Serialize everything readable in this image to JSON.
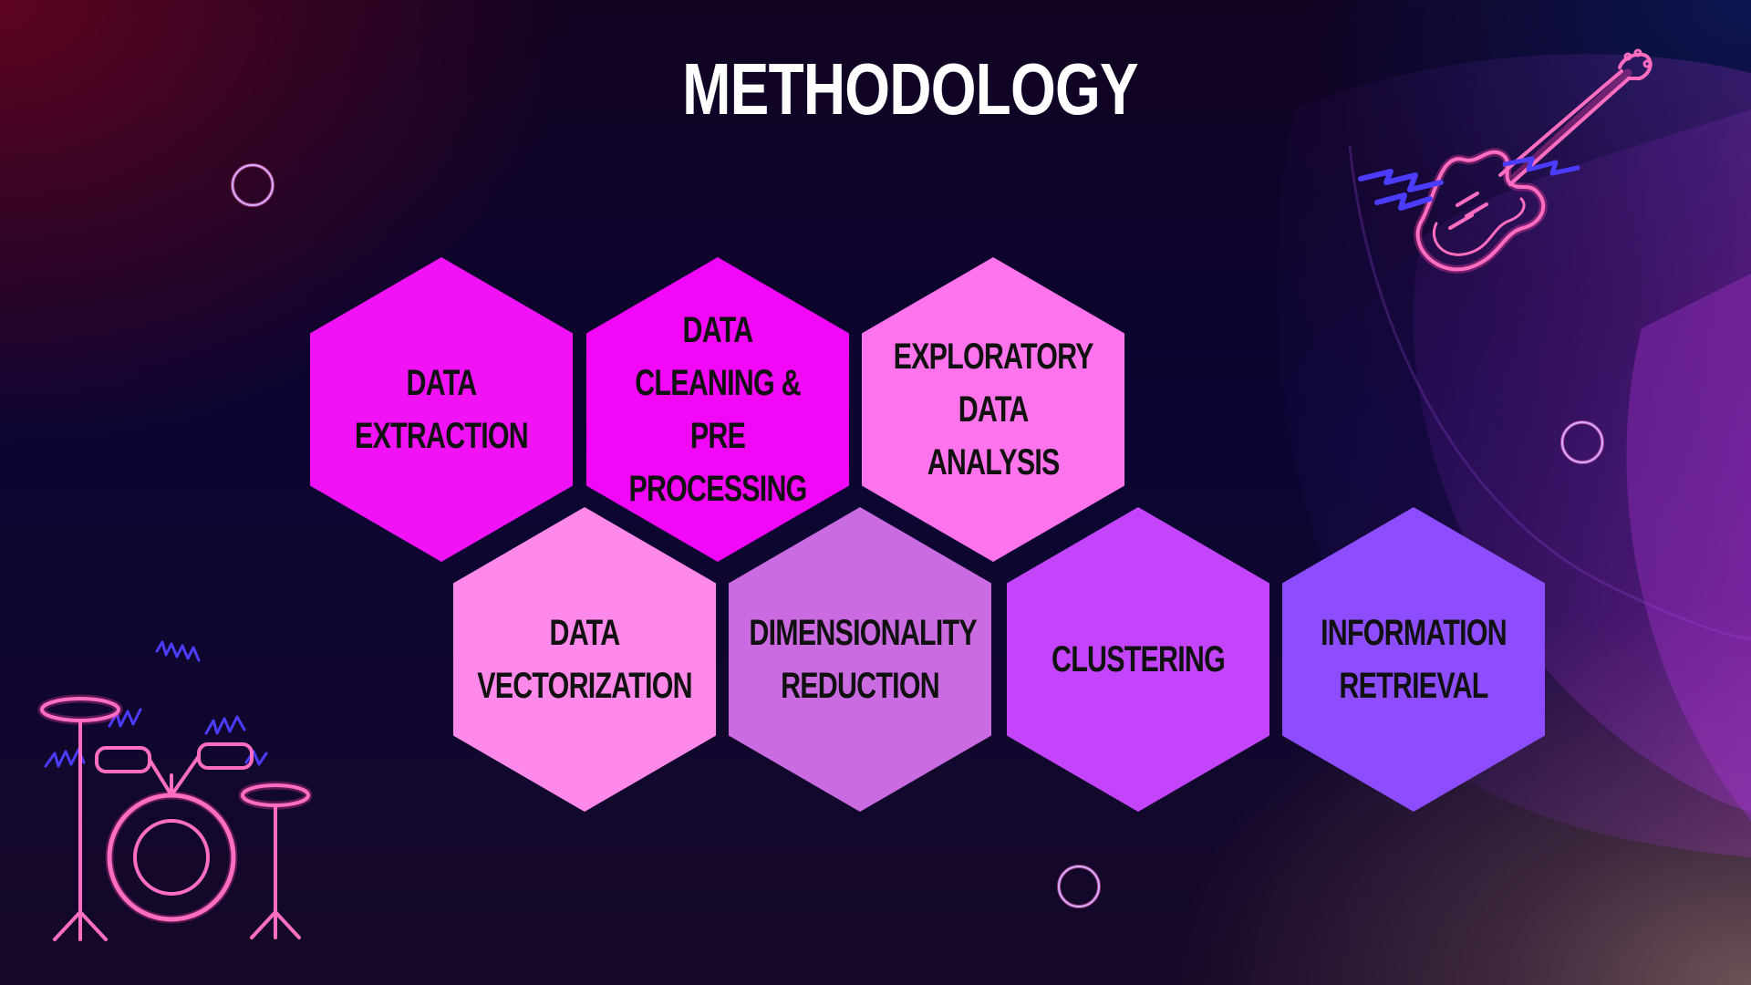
{
  "slide": {
    "title": "METHODOLOGY"
  },
  "hexagons": [
    {
      "label": "DATA\nEXTRACTION",
      "color": "#f113f5"
    },
    {
      "label": "DATA\nCLEANING &\nPRE PROCESSING",
      "color": "#f207f7"
    },
    {
      "label": "EXPLORATORY\nDATA ANALYSIS",
      "color": "#ff73ec"
    },
    {
      "label": "DATA\nVECTORIZATION",
      "color": "#ff89ea"
    },
    {
      "label": "DIMENSIONALITY\nREDUCTION",
      "color": "#cb6be2"
    },
    {
      "label": "CLUSTERING",
      "color": "#c444fb"
    },
    {
      "label": "INFORMATION\nRETRIEVAL",
      "color": "#8d4dff"
    }
  ],
  "decorations": {
    "ring_color": "#c79aff",
    "neon_pink": "#ff4fae",
    "neon_blue": "#4b3cff",
    "icons": [
      "drum-kit-icon",
      "electric-guitar-icon",
      "ring-icon"
    ]
  }
}
